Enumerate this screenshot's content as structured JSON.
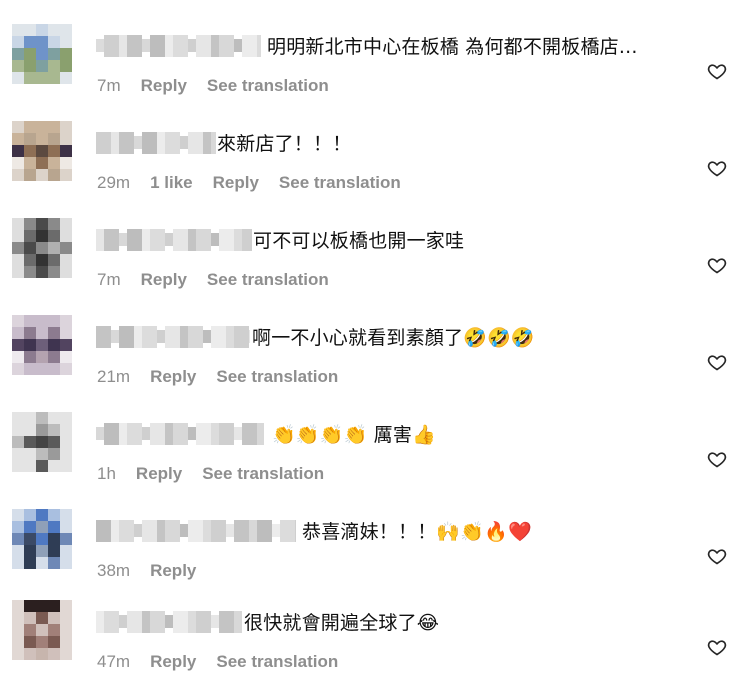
{
  "comments": [
    {
      "text": "明明新北市中心在板橋 為何都不開板橋店...",
      "time": "7m",
      "likes": "",
      "reply_label": "Reply",
      "translate_label": "See translation"
    },
    {
      "text": "來新店了！！！",
      "time": "29m",
      "likes": "1 like",
      "reply_label": "Reply",
      "translate_label": "See translation"
    },
    {
      "text": "可不可以板橋也開一家哇",
      "time": "7m",
      "likes": "",
      "reply_label": "Reply",
      "translate_label": "See translation"
    },
    {
      "text": "啊一不小心就看到素顏了🤣🤣🤣",
      "time": "21m",
      "likes": "",
      "reply_label": "Reply",
      "translate_label": "See translation"
    },
    {
      "text": "👏👏👏👏 厲害👍",
      "time": "1h",
      "likes": "",
      "reply_label": "Reply",
      "translate_label": "See translation"
    },
    {
      "text": "恭喜滴妹！！！🙌👏🔥❤️",
      "time": "38m",
      "likes": "",
      "reply_label": "Reply",
      "translate_label": ""
    },
    {
      "text": "很快就會開遍全球了😂",
      "time": "47m",
      "likes": "",
      "reply_label": "Reply",
      "translate_label": "See translation"
    }
  ],
  "icons": {
    "like": "heart-outline-icon"
  },
  "colors": {
    "text": "#111111",
    "muted": "#8e8e8e"
  }
}
